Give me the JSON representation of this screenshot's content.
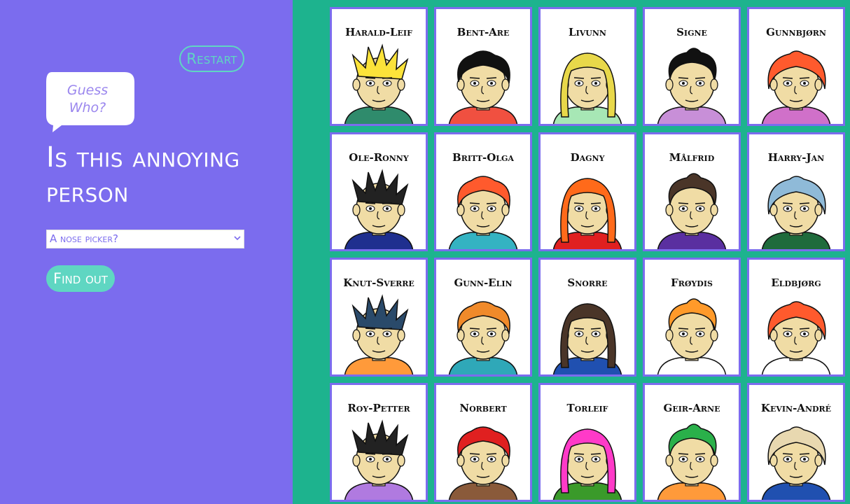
{
  "sidebar": {
    "restart_label": "Restart",
    "logo_text": [
      "Guess",
      "Who?"
    ],
    "question": "Is this annoying person",
    "select": {
      "value": "A nose picker?"
    },
    "findout_label": "Find out"
  },
  "colors": {
    "sidebar_bg": "#7b6cee",
    "board_bg": "#1db38e",
    "accent": "#5fd6c2",
    "card_border": "#7b6cee",
    "skin": "#f0dca5",
    "outline": "#111111"
  },
  "characters": [
    {
      "name": "Harald-Leif",
      "hair": "#fce33a",
      "shirt": "#2f8b6c",
      "icon": "spiky-hair-glasses-icon"
    },
    {
      "name": "Bent-Are",
      "hair": "#111111",
      "shirt": "#f05040",
      "icon": "curly-black-hair-icon"
    },
    {
      "name": "Livunn",
      "hair": "#e8d84a",
      "shirt": "#a7e7b5",
      "icon": "blonde-mask-icon"
    },
    {
      "name": "Signe",
      "hair": "#111111",
      "shirt": "#c88fd8",
      "icon": "messy-black-hair-icon"
    },
    {
      "name": "Gunnbjørn",
      "hair": "#ff5a2d",
      "shirt": "#d070c9",
      "icon": "red-hair-glasses-icon"
    },
    {
      "name": "Ole-Ronny",
      "hair": "#222222",
      "shirt": "#1f2f8f",
      "icon": "curly-hair-icon"
    },
    {
      "name": "Britt-Olga",
      "hair": "#ff5a2d",
      "shirt": "#34b3c2",
      "icon": "red-curly-hair-icon"
    },
    {
      "name": "Dagny",
      "hair": "#ff6a1a",
      "shirt": "#e02020",
      "icon": "angry-fiery-icon"
    },
    {
      "name": "Målfrid",
      "hair": "#4a3528",
      "shirt": "#5a2fa0",
      "icon": "bun-hair-icon"
    },
    {
      "name": "Harry-Jan",
      "hair": "#8fbad8",
      "shirt": "#1f6b3c",
      "icon": "beanie-beard-icon"
    },
    {
      "name": "Knut-Sverre",
      "hair": "#2a4a6a",
      "shirt": "#ff9a3a",
      "icon": "wavy-hair-icon"
    },
    {
      "name": "Gunn-Elin",
      "hair": "#f08a2a",
      "shirt": "#2fa8b8",
      "icon": "long-orange-hair-icon"
    },
    {
      "name": "Snorre",
      "hair": "#4a3528",
      "shirt": "#2050b0",
      "icon": "curly-brown-hair-icon"
    },
    {
      "name": "Frøydis",
      "hair": "#ff9a2a",
      "shirt": "#ffffff",
      "icon": "orange-beanie-icon"
    },
    {
      "name": "Eldbjørg",
      "hair": "#ff5a2d",
      "shirt": "#ffffff",
      "icon": "straight-red-hair-icon"
    },
    {
      "name": "Roy-Petter",
      "hair": "#222222",
      "shirt": "#b07ae0",
      "icon": "spiky-short-hair-icon"
    },
    {
      "name": "Norbert",
      "hair": "#e02020",
      "shirt": "#8a5a3a",
      "icon": "red-spiky-hair-icon"
    },
    {
      "name": "Torleif",
      "hair": "#ff3ac8",
      "shirt": "#3a9a2a",
      "icon": "pink-mohawk-icon"
    },
    {
      "name": "Geir-Arne",
      "hair": "#2ab04a",
      "shirt": "#ff9a3a",
      "icon": "green-cap-icon"
    },
    {
      "name": "Kevin-André",
      "hair": "#e8d8b0",
      "shirt": "#2050b0",
      "icon": "bald-icon"
    }
  ]
}
